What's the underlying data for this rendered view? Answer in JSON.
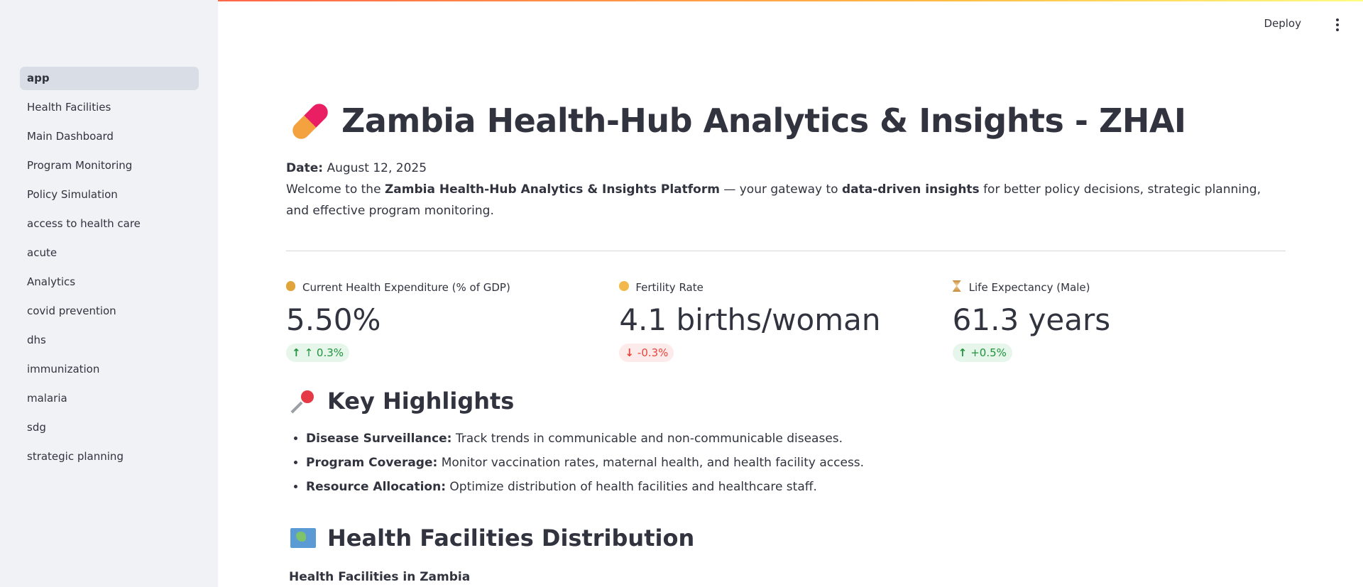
{
  "header": {
    "deploy_label": "Deploy",
    "menu_icon": "more-vertical-icon"
  },
  "sidebar": {
    "items": [
      {
        "label": "app",
        "active": true
      },
      {
        "label": "Health Facilities"
      },
      {
        "label": "Main Dashboard"
      },
      {
        "label": "Program Monitoring"
      },
      {
        "label": "Policy Simulation"
      },
      {
        "label": "access to health care"
      },
      {
        "label": "acute"
      },
      {
        "label": "Analytics"
      },
      {
        "label": "covid prevention"
      },
      {
        "label": "dhs"
      },
      {
        "label": "immunization"
      },
      {
        "label": "malaria"
      },
      {
        "label": "sdg"
      },
      {
        "label": "strategic planning"
      }
    ]
  },
  "main": {
    "title": "Zambia Health-Hub Analytics & Insights - ZHAI",
    "title_icon": "pill-icon",
    "date_label": "Date:",
    "date_value": "August 12, 2025",
    "intro": {
      "part1": "Welcome to the ",
      "bold1": "Zambia Health-Hub Analytics & Insights Platform",
      "part2": " — your gateway to ",
      "bold2": "data-driven insights",
      "part3": " for better policy decisions, strategic planning, and effective program monitoring."
    },
    "metrics": [
      {
        "icon": "money-bag-icon",
        "label": "Current Health Expenditure (% of GDP)",
        "value": "5.50%",
        "delta": "↑ 0.3%",
        "direction": "up"
      },
      {
        "icon": "baby-icon",
        "label": "Fertility Rate",
        "value": "4.1 births/woman",
        "delta": "-0.3%",
        "direction": "down"
      },
      {
        "icon": "hourglass-icon",
        "label": "Life Expectancy (Male)",
        "value": "61.3 years",
        "delta": "+0.5%",
        "direction": "up"
      }
    ],
    "highlights": {
      "icon": "pushpin-icon",
      "title": "Key Highlights",
      "items": [
        {
          "bold": "Disease Surveillance:",
          "text": " Track trends in communicable and non-communicable diseases."
        },
        {
          "bold": "Program Coverage:",
          "text": " Monitor vaccination rates, maternal health, and health facility access."
        },
        {
          "bold": "Resource Allocation:",
          "text": " Optimize distribution of health facilities and healthcare staff."
        }
      ]
    },
    "facilities": {
      "icon": "world-map-icon",
      "title": "Health Facilities Distribution",
      "subheading": "Health Facilities in Zambia"
    }
  },
  "colors": {
    "sidebar_bg": "#f0f2f6",
    "text": "#31333f",
    "delta_up": "#21923d",
    "delta_down": "#e8453c"
  }
}
